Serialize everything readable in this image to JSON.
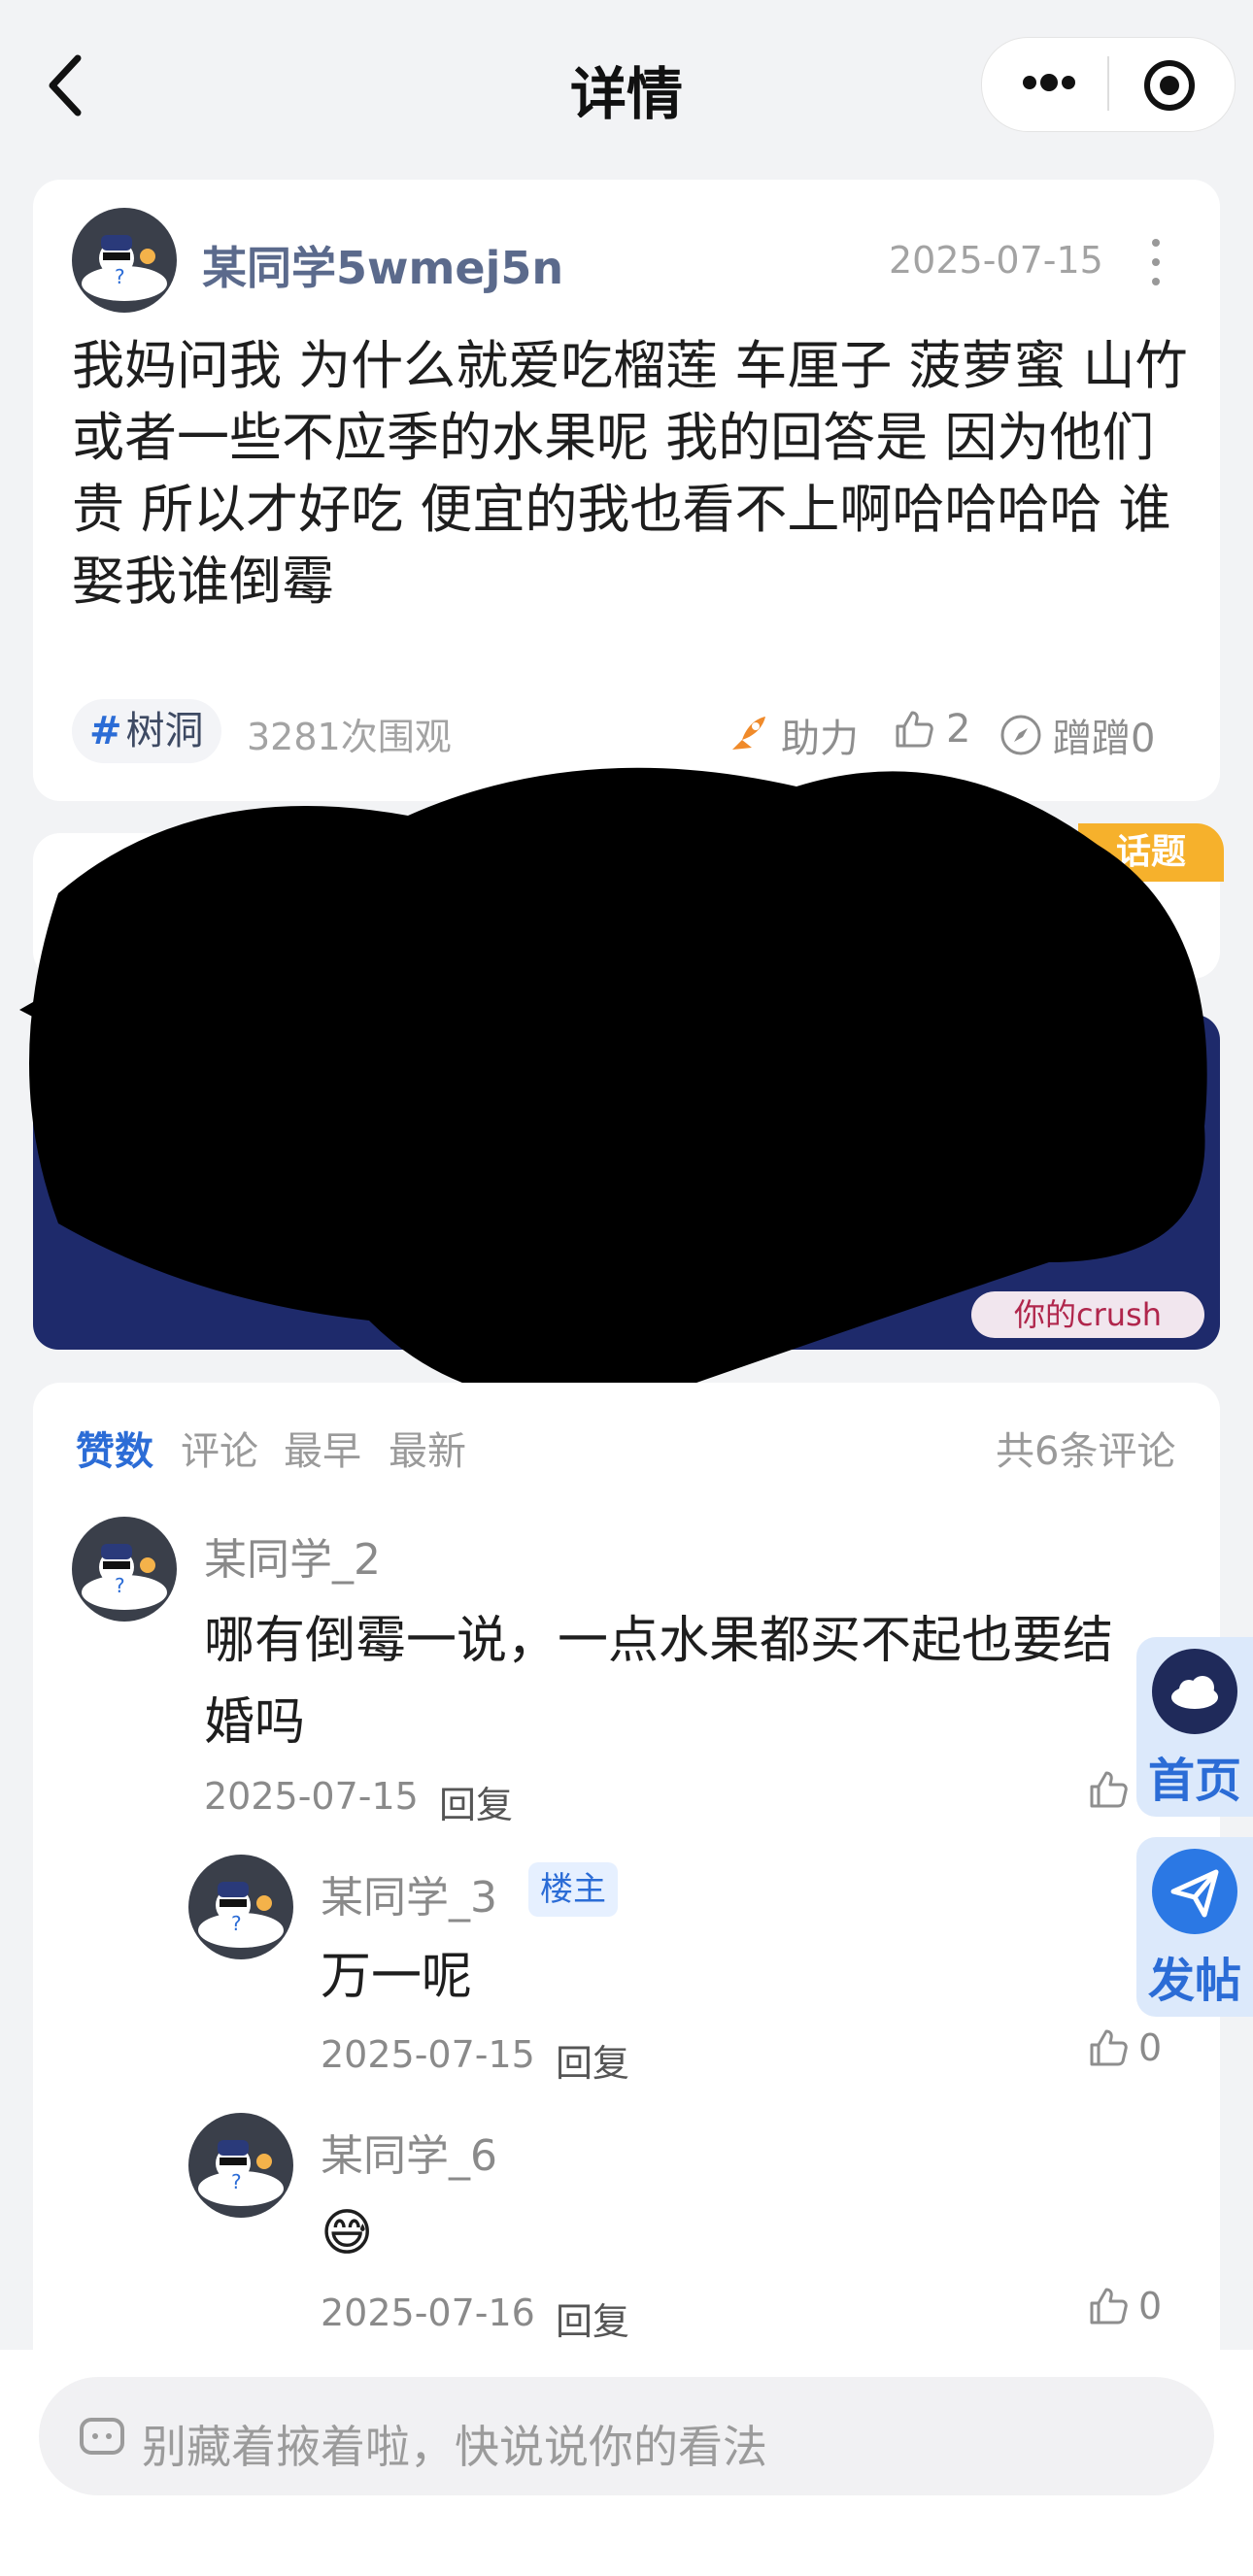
{
  "header": {
    "title": "详情"
  },
  "post": {
    "username": "某同学5wmej5n",
    "date": "2025-07-15",
    "content": "我妈问我 为什么就爱吃榴莲 车厘子 菠萝蜜 山竹或者一些不应季的水果呢 我的回答是 因为他们贵 所以才好吃 便宜的我也看不上啊哈哈哈哈 谁娶我谁倒霉",
    "tag": "树洞",
    "tag_symbol": "#",
    "views": "3281次围观",
    "boost_label": "助力",
    "likes": "2",
    "steps_label": "蹭蹭0"
  },
  "banner": {
    "badge": "话题",
    "pill": "你的crush"
  },
  "comments": {
    "sort_tabs": [
      "赞数",
      "评论",
      "最早",
      "最新"
    ],
    "total": "共6条评论",
    "items": [
      {
        "user": "某同学_2",
        "text": "哪有倒霉一说，一点水果都买不起也要结婚吗",
        "date": "2025-07-15",
        "reply": "回复"
      },
      {
        "user": "某同学_3",
        "badge": "楼主",
        "text": "万一呢",
        "date": "2025-07-15",
        "reply": "回复",
        "likes": "0"
      },
      {
        "user": "某同学_6",
        "text": "😅",
        "date": "2025-07-16",
        "reply": "回复",
        "likes": "0"
      }
    ]
  },
  "float": {
    "home": "首页",
    "post": "发帖"
  },
  "input": {
    "placeholder": "别藏着掖着啦，快说说你的看法"
  }
}
